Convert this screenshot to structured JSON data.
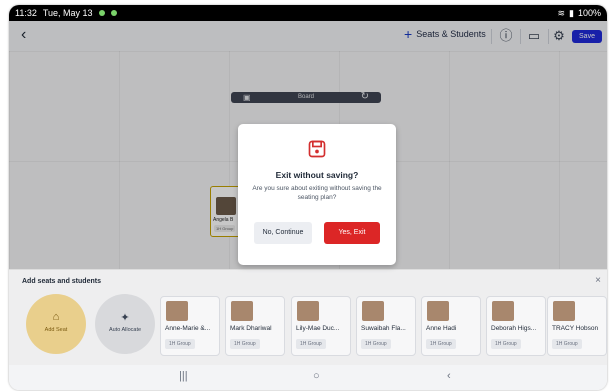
{
  "status": {
    "time": "11:32",
    "date": "Tue, May 13",
    "battery": "100%"
  },
  "toolbar": {
    "back_icon": "chevron-left-icon",
    "seats_students_label": "Seats & Students",
    "save_label": "Save"
  },
  "canvas": {
    "board_label": "Board"
  },
  "seat": {
    "name": "Angela B",
    "group": "1H Group"
  },
  "modal": {
    "title": "Exit without saving?",
    "message": "Are you sure about exiting without saving the seating plan?",
    "no_label": "No, Continue",
    "yes_label": "Yes, Exit",
    "accent": "#dc2626"
  },
  "panel": {
    "title": "Add seats and students",
    "add_seat_label": "Add Seat",
    "auto_allocate_label": "Auto Allocate",
    "students": [
      {
        "name": "Anne-Marie &...",
        "group": "1H Group"
      },
      {
        "name": "Mark Dhariwal",
        "group": "1H Group"
      },
      {
        "name": "Lily-Mae Duc...",
        "group": "1H Group"
      },
      {
        "name": "Suwaibah Fla...",
        "group": "1H Group"
      },
      {
        "name": "Anne Hadi",
        "group": "1H Group"
      },
      {
        "name": "Deborah Higs...",
        "group": "1H Group"
      },
      {
        "name": "TRACY Hobson",
        "group": "1H Group"
      }
    ]
  }
}
